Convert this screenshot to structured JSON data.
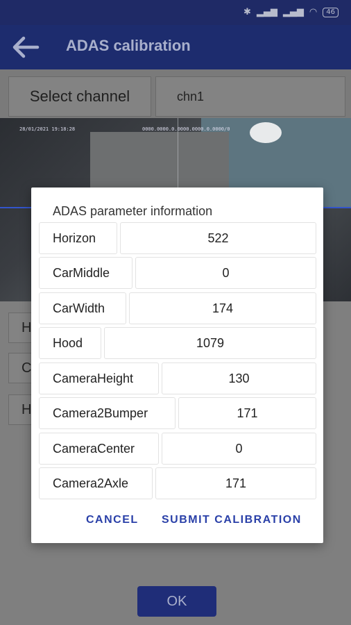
{
  "status_bar": {
    "battery": "46"
  },
  "app_bar": {
    "title": "ADAS calibration",
    "back_icon": "arrow-left-icon"
  },
  "channel": {
    "label": "Select channel",
    "value": "chn1"
  },
  "video": {
    "osd_left": "28/01/2021 19:18:28",
    "osd_right": "0000.0000.0.0000.0000.0.0000/0"
  },
  "background_fields": [
    "H",
    "C",
    "H"
  ],
  "dialog": {
    "title": "ADAS parameter information",
    "params": [
      {
        "label": "Horizon",
        "value": "522"
      },
      {
        "label": "CarMiddle",
        "value": "0"
      },
      {
        "label": "CarWidth",
        "value": "174"
      },
      {
        "label": "Hood",
        "value": "1079"
      },
      {
        "label": "CameraHeight",
        "value": "130"
      },
      {
        "label": "Camera2Bumper",
        "value": "171"
      },
      {
        "label": "CameraCenter",
        "value": "0"
      },
      {
        "label": "Camera2Axle",
        "value": "171"
      }
    ],
    "cancel_label": "CANCEL",
    "submit_label": "SUBMIT CALIBRATION"
  },
  "ok_label": "OK"
}
